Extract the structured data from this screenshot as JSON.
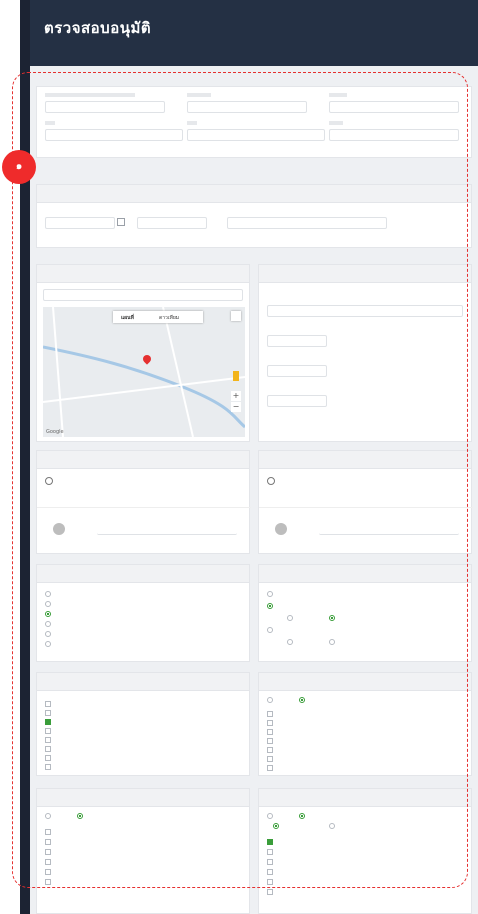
{
  "header": {
    "title": "ตรวจสอบอนุมัติ"
  },
  "badge": {
    "label": "๑"
  },
  "colors": {
    "header": "#243044",
    "sidebar": "#1c2333",
    "accent_red": "#e53030",
    "check_green": "#3a9d3a"
  },
  "map": {
    "tab_map": "แผนที่",
    "tab_satellite": "ดาวเทียม",
    "attribution": "Google",
    "zoom_in": "+",
    "zoom_out": "−"
  },
  "icons": [
    "search-icon",
    "calendar-icon",
    "map-pin-icon",
    "fullscreen-icon",
    "pegman-icon",
    "user-add-icon",
    "chevron-down-icon"
  ]
}
